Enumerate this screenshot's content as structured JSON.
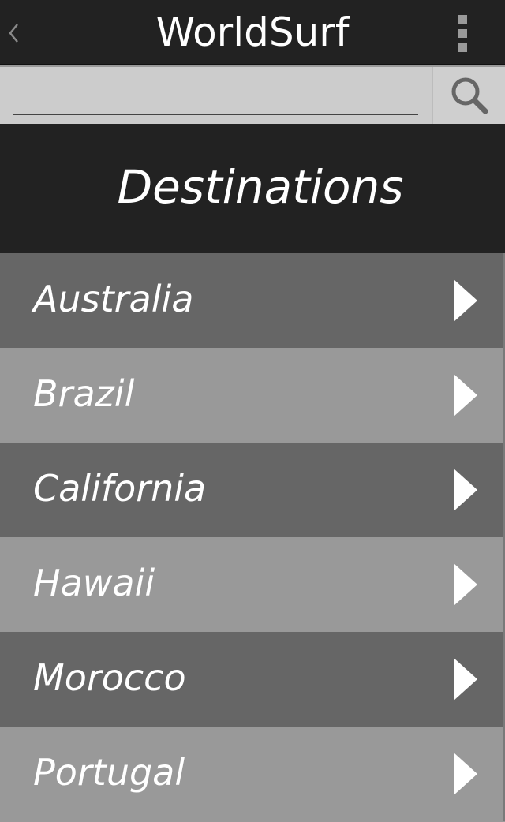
{
  "header": {
    "title": "WorldSurf",
    "back_icon": "chevron-left-icon",
    "menu_icon": "overflow-menu-icon"
  },
  "search": {
    "value": "",
    "placeholder": "",
    "icon": "search-icon"
  },
  "section": {
    "title": "Destinations"
  },
  "destinations": [
    {
      "label": "Australia",
      "icon": "chevron-right-icon"
    },
    {
      "label": "Brazil",
      "icon": "chevron-right-icon"
    },
    {
      "label": "California",
      "icon": "chevron-right-icon"
    },
    {
      "label": "Hawaii",
      "icon": "chevron-right-icon"
    },
    {
      "label": "Morocco",
      "icon": "chevron-right-icon"
    },
    {
      "label": "Portugal",
      "icon": "chevron-right-icon"
    }
  ],
  "colors": {
    "topbar": "#222222",
    "row_dark": "#666666",
    "row_light": "#999999",
    "text": "#ffffff"
  }
}
